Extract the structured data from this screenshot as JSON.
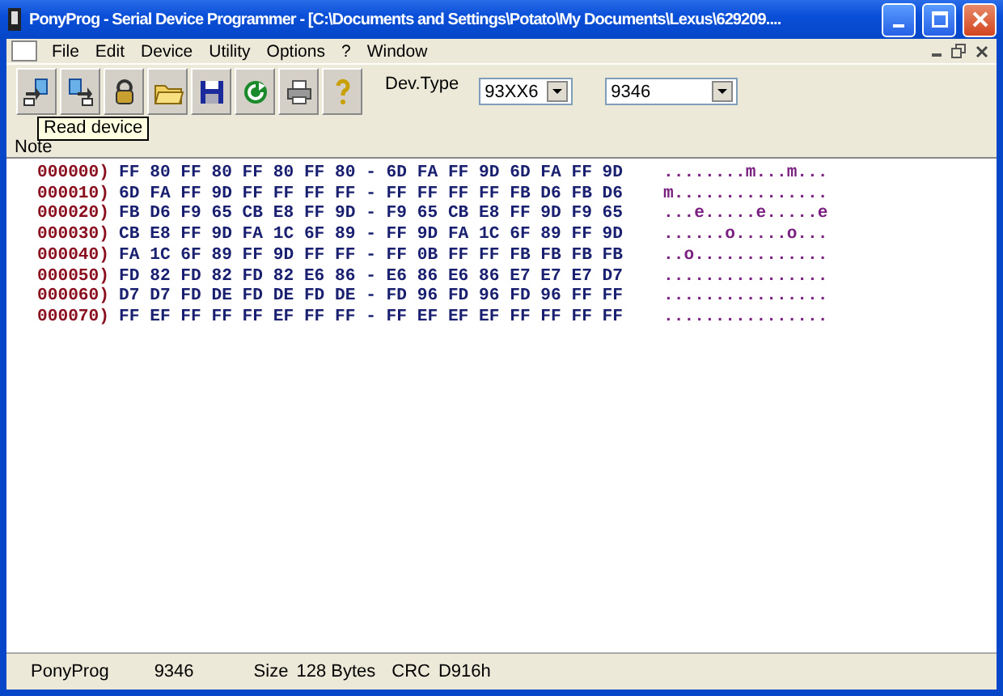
{
  "window": {
    "title": "PonyProg - Serial Device Programmer - [C:\\Documents and Settings\\Potato\\My Documents\\Lexus\\629209...."
  },
  "menu": [
    "File",
    "Edit",
    "Device",
    "Utility",
    "Options",
    "?",
    "Window"
  ],
  "toolbar": {
    "tooltip": "Read device",
    "dev_type_label": "Dev.Type",
    "family": "93XX6",
    "device": "9346"
  },
  "tabs": [
    {
      "label": "Note"
    }
  ],
  "hex_rows": [
    {
      "address": "000000)",
      "bytes": "FF 80 FF 80 FF 80 FF 80 - 6D FA FF 9D 6D FA FF 9D",
      "ascii": "........m...m..."
    },
    {
      "address": "000010)",
      "bytes": "6D FA FF 9D FF FF FF FF - FF FF FF FF FB D6 FB D6",
      "ascii": "m..............."
    },
    {
      "address": "000020)",
      "bytes": "FB D6 F9 65 CB E8 FF 9D - F9 65 CB E8 FF 9D F9 65",
      "ascii": "...e.....e.....e"
    },
    {
      "address": "000030)",
      "bytes": "CB E8 FF 9D FA 1C 6F 89 - FF 9D FA 1C 6F 89 FF 9D",
      "ascii": "......o.....o..."
    },
    {
      "address": "000040)",
      "bytes": "FA 1C 6F 89 FF 9D FF FF - FF 0B FF FF FB FB FB FB",
      "ascii": "..o............."
    },
    {
      "address": "000050)",
      "bytes": "FD 82 FD 82 FD 82 E6 86 - E6 86 E6 86 E7 E7 E7 D7",
      "ascii": "................"
    },
    {
      "address": "000060)",
      "bytes": "D7 D7 FD DE FD DE FD DE - FD 96 FD 96 FD 96 FF FF",
      "ascii": "................"
    },
    {
      "address": "000070)",
      "bytes": "FF EF FF FF FF EF FF FF - FF EF EF EF FF FF FF FF",
      "ascii": "................"
    }
  ],
  "status_bar": {
    "app": "PonyProg",
    "device": "9346",
    "size_label": "Size",
    "size": "128 Bytes",
    "crc_label": "CRC",
    "crc": "D916h"
  }
}
